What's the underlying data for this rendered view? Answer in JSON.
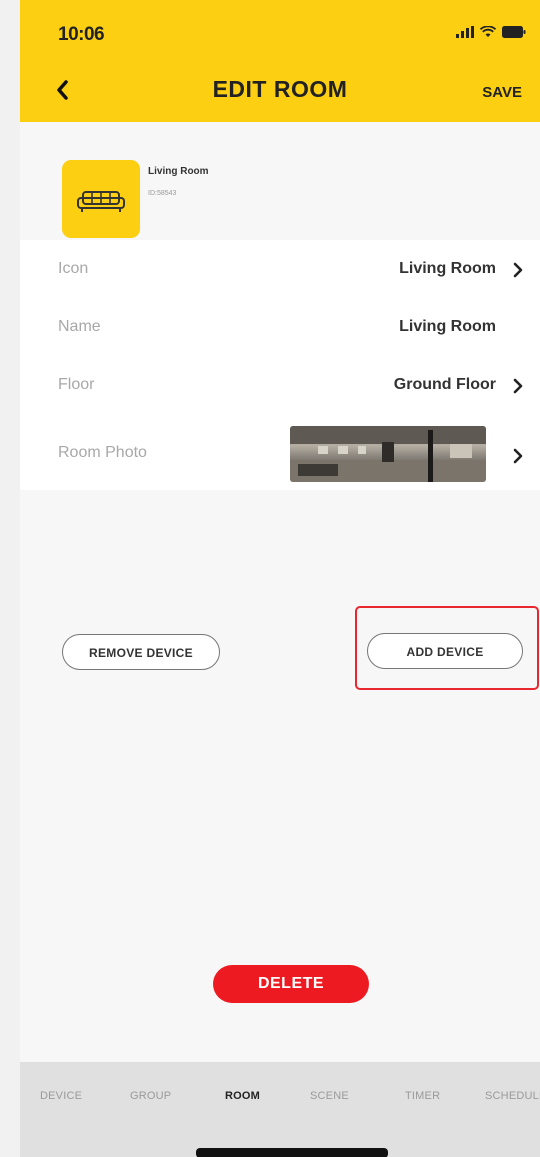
{
  "status": {
    "time": "10:06"
  },
  "header": {
    "title": "EDIT ROOM",
    "save_label": "SAVE"
  },
  "room": {
    "name": "Living Room",
    "id": "ID:58543",
    "icon": "sofa-icon"
  },
  "rows": [
    {
      "label": "Icon",
      "value": "Living Room"
    },
    {
      "label": "Name",
      "value": "Living Room"
    },
    {
      "label": "Floor",
      "value": "Ground Floor"
    },
    {
      "label": "Room Photo"
    }
  ],
  "actions": {
    "remove_device": "REMOVE DEVICE",
    "add_device": "ADD DEVICE",
    "delete": "DELETE"
  },
  "tabs": [
    "DEVICE",
    "GROUP",
    "ROOM",
    "SCENE",
    "TIMER",
    "SCHEDULE"
  ],
  "active_tab": "ROOM",
  "colors": {
    "accent": "#fccf12",
    "danger": "#ee1a22",
    "highlight": "#e8282e"
  }
}
